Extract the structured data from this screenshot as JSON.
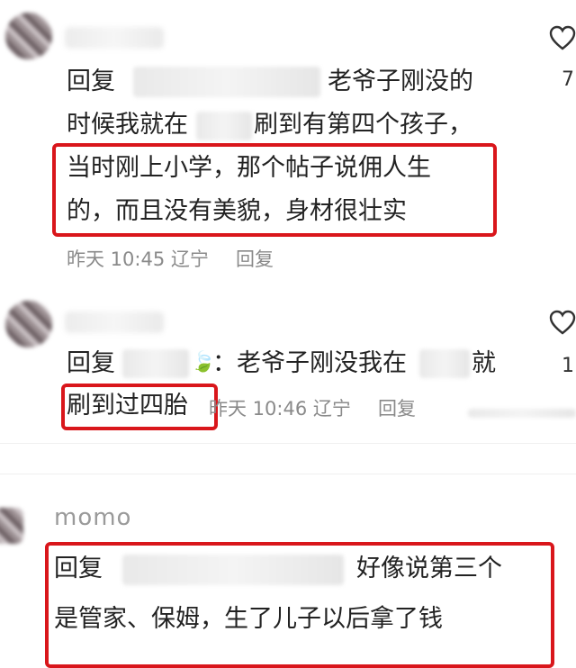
{
  "comments": [
    {
      "reply_label": "回复",
      "text_segments": [
        "老爷子刚没的",
        "时候我就在",
        "刷到有第四个孩子，",
        "当时刚上小学，那个帖子说佣人生",
        "的，而且没有美貌，身材很壮实"
      ],
      "time": "昨天 10:45",
      "location": "辽宁",
      "reply_button": "回复",
      "like_count": "7"
    },
    {
      "reply_label": "回复",
      "text_segments": [
        "：老爷子刚没我在",
        "就",
        "刷到过四胎"
      ],
      "time": "昨天 10:46",
      "location": "辽宁",
      "reply_button": "回复",
      "like_count": "1"
    },
    {
      "username": "momo",
      "reply_label": "回复",
      "text_segments": [
        "好像说第三个",
        "是管家、保姆，生了儿子以后拿了钱"
      ]
    }
  ],
  "colors": {
    "highlight_box": "#d9161b",
    "meta_text": "#8a8a8a"
  },
  "icons": [
    "heart-outline-icon",
    "leaf-icon"
  ]
}
